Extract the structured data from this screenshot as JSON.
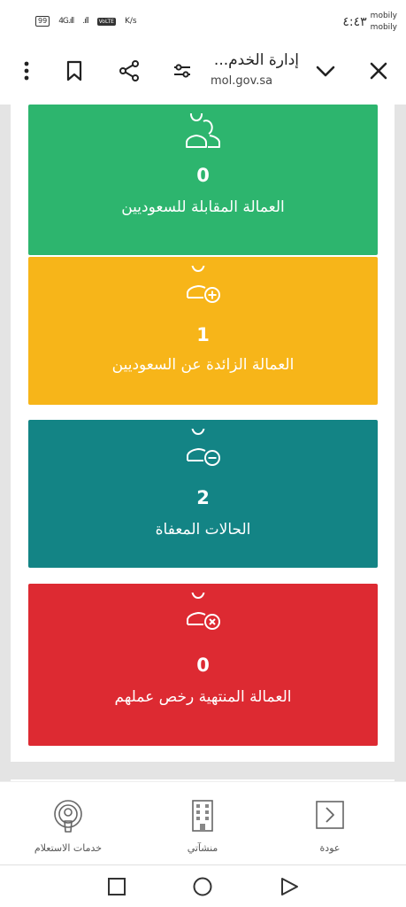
{
  "status_bar": {
    "battery": "99",
    "network": "4G",
    "speed": "K/s",
    "volte": "VoLTE",
    "time": "٤:٤٣",
    "carrier_1": "mobily",
    "carrier_2": "mobily"
  },
  "browser": {
    "title": "إدارة الخدم...",
    "url": "mol.gov.sa"
  },
  "cards": [
    {
      "count": "0",
      "label": "العمالة المقابلة للسعوديين",
      "icon": "users-icon",
      "color": "#2db56e"
    },
    {
      "count": "1",
      "label": "العمالة الزائدة عن السعوديين",
      "icon": "user-plus-icon",
      "color": "#f7b519"
    },
    {
      "count": "2",
      "label": "الحالات المعفاة",
      "icon": "user-minus-icon",
      "color": "#138485"
    },
    {
      "count": "0",
      "label": "العمالة المنتهية رخص عملهم",
      "icon": "user-x-icon",
      "color": "#dd2a32"
    }
  ],
  "bottom_nav": {
    "inquiry": "خدمات الاستعلام",
    "establishments": "منشآتي",
    "back": "عودة"
  }
}
